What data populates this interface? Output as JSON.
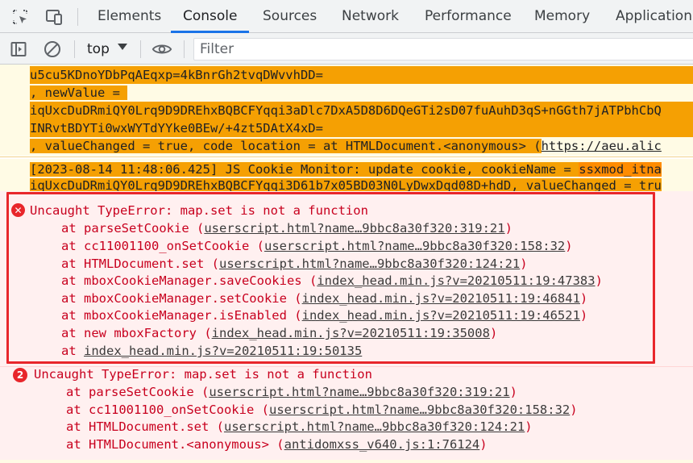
{
  "tabs": [
    {
      "label": "Elements",
      "active": false
    },
    {
      "label": "Console",
      "active": true
    },
    {
      "label": "Sources",
      "active": false
    },
    {
      "label": "Network",
      "active": false
    },
    {
      "label": "Performance",
      "active": false
    },
    {
      "label": "Memory",
      "active": false
    },
    {
      "label": "Application",
      "active": false
    }
  ],
  "toolbar": {
    "context": "top",
    "filter_placeholder": "Filter"
  },
  "log1": {
    "line1": "u5cu5KDnoYDbPqAEqxp=4kBnrGh2tvqDWvvhDD=",
    "line2_prefix": ", newValue = ",
    "line3": "iqUxcDuDRmiQY0Lrq9D9DREhxBQBCFYqqi3aDlc7DxA5D8D6DQeGTi2sD07fuAuhD3qS+nGGth7jATPbhCbQ",
    "line4": "INRvtBDYTi0wxWYTdYYke0BEw/+4zt5DAtX4xD=",
    "line5_a": ", valueChanged = ",
    "line5_true": "true",
    "line5_b": ", code location = at HTMLDocument.<anonymous> (",
    "line5_link": "https://aeu.alic"
  },
  "log2": {
    "line1_a": "[2023-08-14 11:48:06.425] JS Cookie Monitor: update cookie, cookieName = ",
    "line1_name": "ssxmod_itna",
    "line2_a": "iqUxcDuDRmiQY0Lrq9D9DREhxBQBCFYqqi3D61b7x05BD03N0LyDwxDqd08D+hdD",
    "line2_b": ", valueChanged = ",
    "line2_true": "tru"
  },
  "error1": {
    "message": "Uncaught TypeError: map.set is not a function",
    "frames": [
      {
        "fn": "parseSetCookie",
        "link": "userscript.html?name…9bbc8a30f320:319:21"
      },
      {
        "fn": "cc11001100_onSetCookie",
        "link": "userscript.html?name…9bbc8a30f320:158:32"
      },
      {
        "fn": "HTMLDocument.set",
        "link": "userscript.html?name…9bbc8a30f320:124:21"
      },
      {
        "fn": "mboxCookieManager.saveCookies",
        "link": "index_head.min.js?v=20210511:19:47383"
      },
      {
        "fn": "mboxCookieManager.setCookie",
        "link": "index_head.min.js?v=20210511:19:46841"
      },
      {
        "fn": "mboxCookieManager.isEnabled",
        "link": "index_head.min.js?v=20210511:19:46521"
      },
      {
        "fn": "new mboxFactory",
        "link": "index_head.min.js?v=20210511:19:35008"
      },
      {
        "fn": "",
        "link": "index_head.min.js?v=20210511:19:50135"
      }
    ]
  },
  "error2": {
    "count": "2",
    "message": "Uncaught TypeError: map.set is not a function",
    "frames": [
      {
        "fn": "parseSetCookie",
        "link": "userscript.html?name…9bbc8a30f320:319:21"
      },
      {
        "fn": "cc11001100_onSetCookie",
        "link": "userscript.html?name…9bbc8a30f320:158:32"
      },
      {
        "fn": "HTMLDocument.set",
        "link": "userscript.html?name…9bbc8a30f320:124:21"
      },
      {
        "fn": "HTMLDocument.<anonymous>",
        "link": "antidomxss_v640.js:1:76124"
      }
    ]
  },
  "colors": {
    "accent": "#1a73e8",
    "error": "#e8262b",
    "highlight": "#f5a003"
  }
}
